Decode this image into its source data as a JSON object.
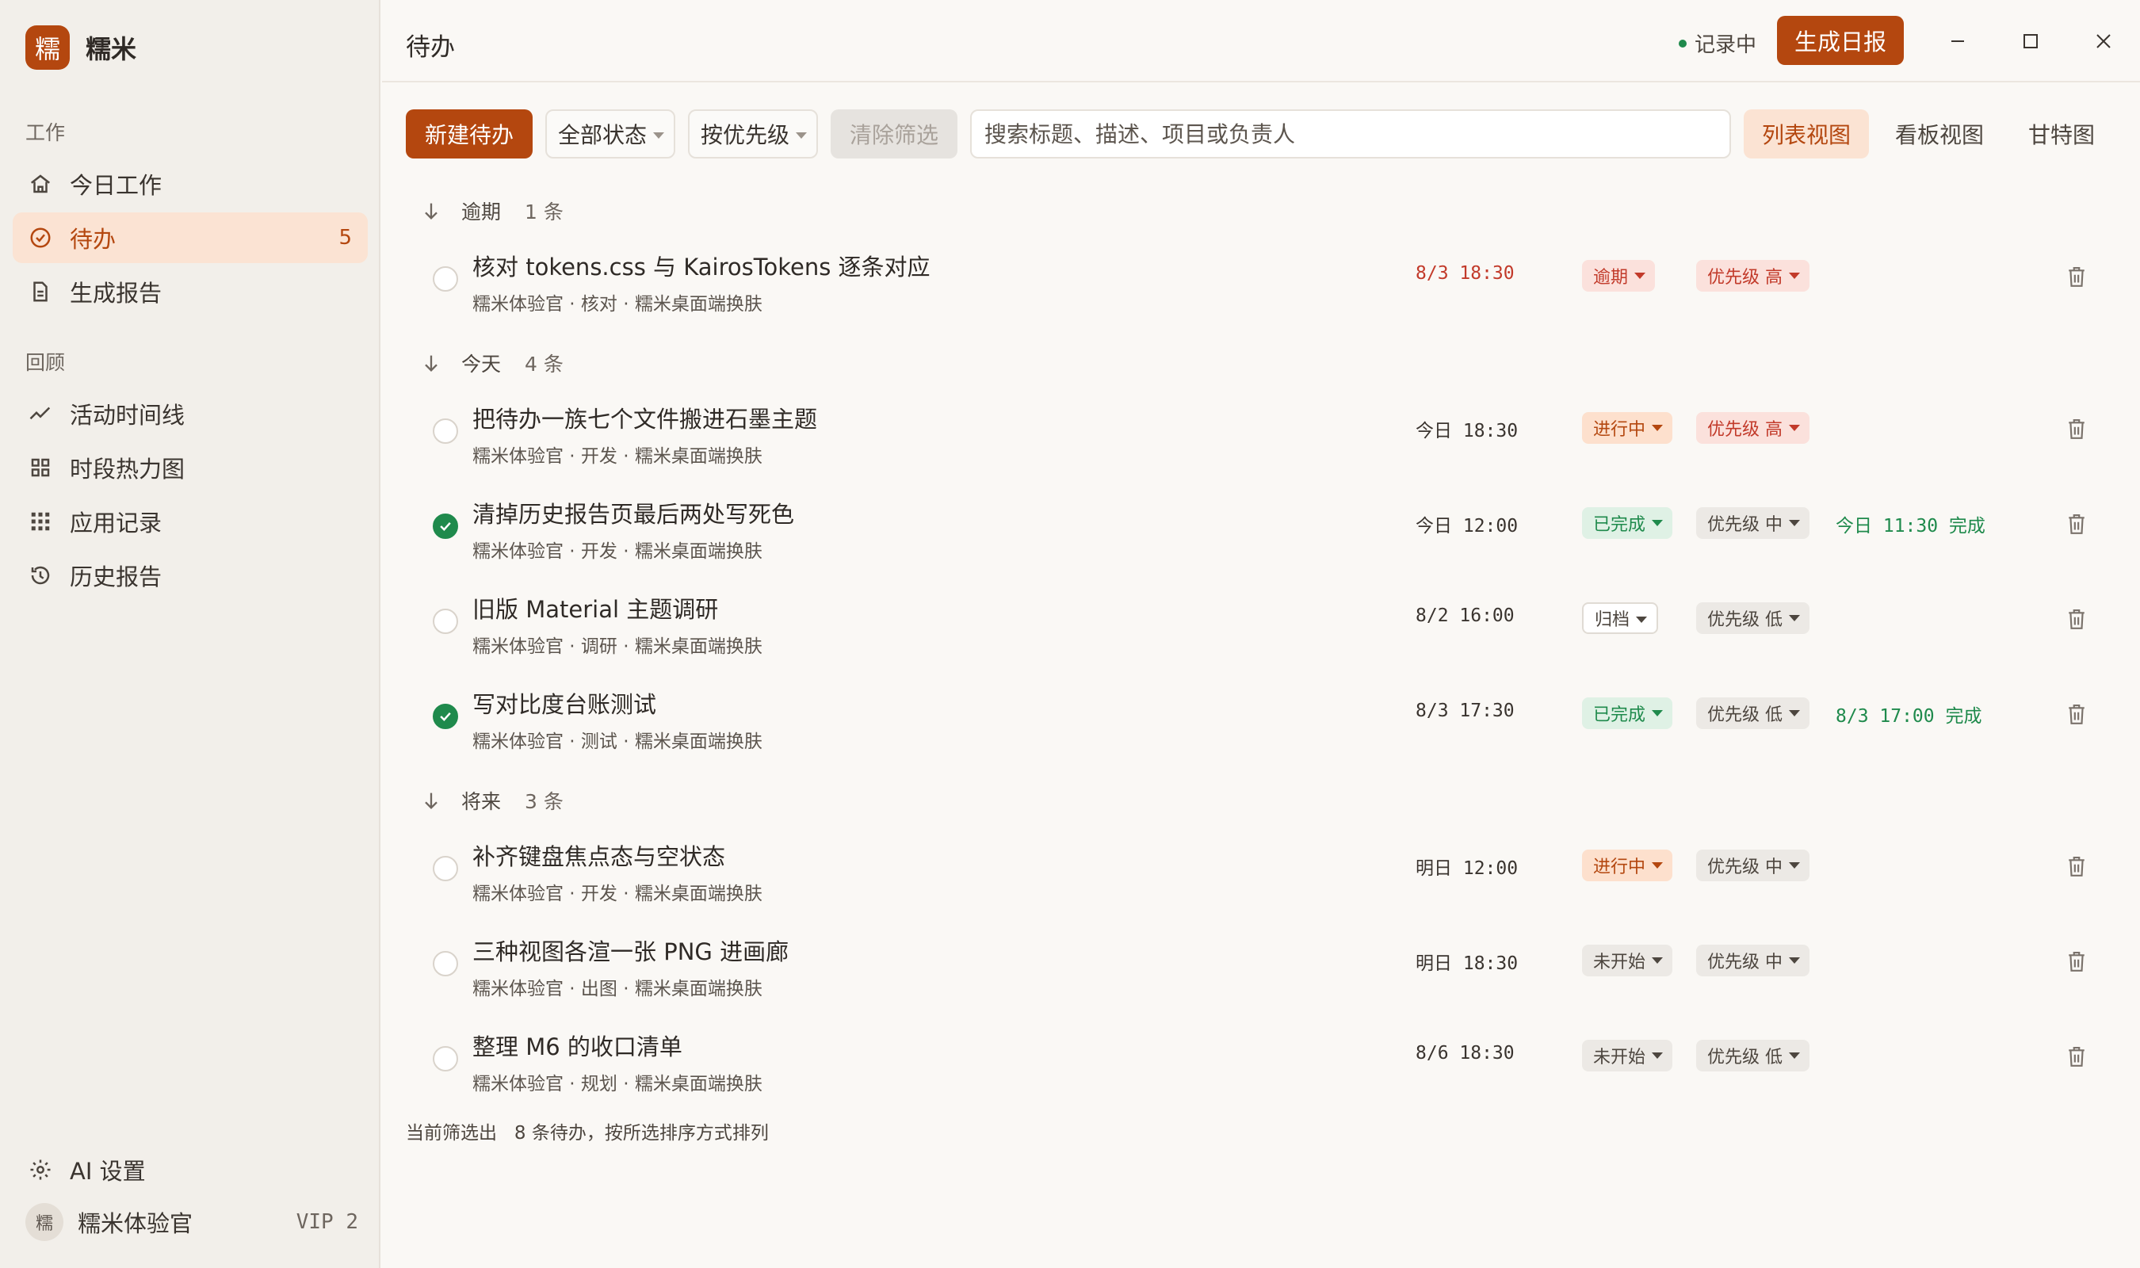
{
  "brand": {
    "logo": "糯",
    "name": "糯米"
  },
  "sidebar": {
    "sections": [
      {
        "title": "工作"
      },
      {
        "title": "回顾"
      }
    ],
    "work_items": [
      {
        "label": "今日工作",
        "icon": "home-icon"
      },
      {
        "label": "待办",
        "icon": "check-circle-icon",
        "count": "5",
        "active": true
      },
      {
        "label": "生成报告",
        "icon": "document-icon"
      }
    ],
    "review_items": [
      {
        "label": "活动时间线",
        "icon": "trend-line-icon"
      },
      {
        "label": "时段热力图",
        "icon": "grid-icon"
      },
      {
        "label": "应用记录",
        "icon": "dots-grid-icon"
      },
      {
        "label": "历史报告",
        "icon": "history-icon"
      }
    ],
    "settings_label": "AI 设置",
    "user": {
      "avatar": "糯",
      "name": "糯米体验官",
      "vip": "VIP 2"
    }
  },
  "header": {
    "title": "待办",
    "recording": "记录中",
    "generate_label": "生成日报"
  },
  "toolbar": {
    "new_label": "新建待办",
    "status_filter": "全部状态",
    "sort": "按优先级",
    "clear_label": "清除筛选",
    "search_placeholder": "搜索标题、描述、项目或负责人",
    "views": [
      "列表视图",
      "看板视图",
      "甘特图"
    ]
  },
  "groups": [
    {
      "label": "逾期",
      "count": "1 条"
    },
    {
      "label": "今天",
      "count": "4 条"
    },
    {
      "label": "将来",
      "count": "3 条"
    }
  ],
  "tasks": [
    {
      "title": "核对 tokens.css 与 KairosTokens 逐条对应",
      "meta": "糯米体验官 · 核对 · 糯米桌面端换肤",
      "time": "8/3 18:30",
      "status": "逾期",
      "priority": "优先级 高",
      "done": false,
      "done_note": ""
    },
    {
      "title": "把待办一族七个文件搬进石墨主题",
      "meta": "糯米体验官 · 开发 · 糯米桌面端换肤",
      "time": "今日 18:30",
      "status": "进行中",
      "priority": "优先级 高",
      "done": false,
      "done_note": ""
    },
    {
      "title": "清掉历史报告页最后两处写死色",
      "meta": "糯米体验官 · 开发 · 糯米桌面端换肤",
      "time": "今日 12:00",
      "status": "已完成",
      "priority": "优先级 中",
      "done": true,
      "done_note": "今日 11:30 完成"
    },
    {
      "title": "旧版 Material 主题调研",
      "meta": "糯米体验官 · 调研 · 糯米桌面端换肤",
      "time": "8/2 16:00",
      "status": "归档",
      "priority": "优先级 低",
      "done": false,
      "done_note": ""
    },
    {
      "title": "写对比度台账测试",
      "meta": "糯米体验官 · 测试 · 糯米桌面端换肤",
      "time": "8/3 17:30",
      "status": "已完成",
      "priority": "优先级 低",
      "done": true,
      "done_note": "8/3 17:00 完成"
    },
    {
      "title": "补齐键盘焦点态与空状态",
      "meta": "糯米体验官 · 开发 · 糯米桌面端换肤",
      "time": "明日 12:00",
      "status": "进行中",
      "priority": "优先级 中",
      "done": false,
      "done_note": ""
    },
    {
      "title": "三种视图各渲一张 PNG 进画廊",
      "meta": "糯米体验官 · 出图 · 糯米桌面端换肤",
      "time": "明日 18:30",
      "status": "未开始",
      "priority": "优先级 中",
      "done": false,
      "done_note": ""
    },
    {
      "title": "整理 M6 的收口清单",
      "meta": "糯米体验官 · 规划 · 糯米桌面端换肤",
      "time": "8/6 18:30",
      "status": "未开始",
      "priority": "优先级 低",
      "done": false,
      "done_note": ""
    }
  ],
  "footer": "当前筛选出   8 条待办，按所选排序方式排列",
  "colors": {
    "accent": "#b4470f",
    "accent_soft": "#fbe3d3",
    "success": "#1f8a4c",
    "danger": "#c23a2a"
  }
}
